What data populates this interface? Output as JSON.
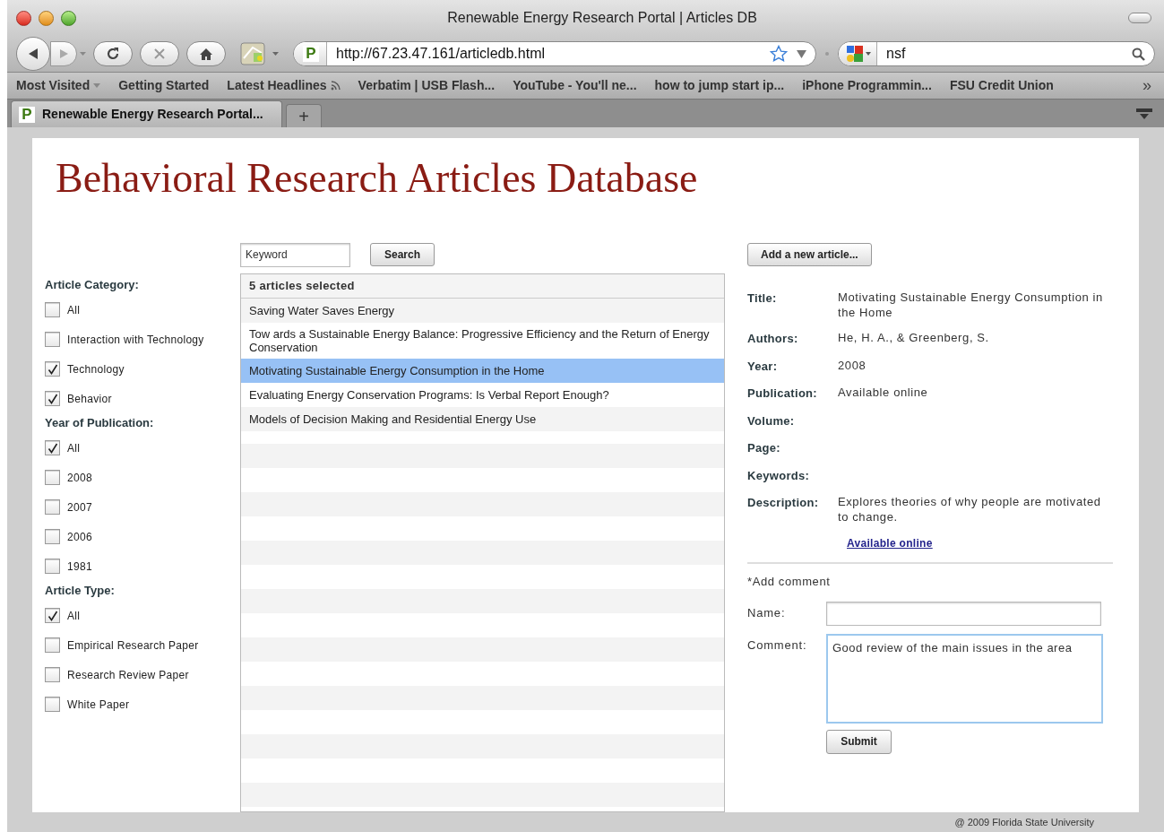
{
  "browser": {
    "title": "Renewable Energy Research Portal | Articles DB",
    "url": "http://67.23.47.161/articledb.html",
    "search_value": "nsf",
    "site_letter": "P",
    "bookmarks": [
      {
        "label": "Most Visited",
        "kind": "menu"
      },
      {
        "label": "Getting Started",
        "kind": "link"
      },
      {
        "label": "Latest Headlines",
        "kind": "feed"
      },
      {
        "label": "Verbatim | USB Flash...",
        "kind": "link"
      },
      {
        "label": "YouTube - You'll ne...",
        "kind": "link"
      },
      {
        "label": "how to jump start ip...",
        "kind": "link"
      },
      {
        "label": "iPhone Programmin...",
        "kind": "link"
      },
      {
        "label": "FSU Credit Union",
        "kind": "link"
      }
    ],
    "more": "»",
    "tabs": [
      {
        "label": "Renewable Energy Research Portal...",
        "site_letter": "P",
        "selected": true
      }
    ],
    "new_tab": "+"
  },
  "page": {
    "heading": "Behavioral Research Articles Database",
    "keyword_placeholder": "Keyword",
    "search_button": "Search",
    "add_button": "Add a new article...",
    "filters": [
      {
        "title": "Article Category:",
        "options": [
          {
            "label": "All",
            "checked": false
          },
          {
            "label": "Interaction with Technology",
            "checked": false
          },
          {
            "label": "Technology",
            "checked": true
          },
          {
            "label": "Behavior",
            "checked": true
          }
        ]
      },
      {
        "title": "Year of Publication:",
        "options": [
          {
            "label": "All",
            "checked": true
          },
          {
            "label": "2008",
            "checked": false
          },
          {
            "label": "2007",
            "checked": false
          },
          {
            "label": "2006",
            "checked": false
          },
          {
            "label": "1981",
            "checked": false
          }
        ]
      },
      {
        "title": "Article Type:",
        "options": [
          {
            "label": "All",
            "checked": true
          },
          {
            "label": "Empirical Research Paper",
            "checked": false
          },
          {
            "label": "Research Review Paper",
            "checked": false
          },
          {
            "label": "White Paper",
            "checked": false
          }
        ]
      }
    ],
    "articles": {
      "header": "5 articles selected",
      "items": [
        {
          "title": "Saving Water Saves Energy",
          "selected": false
        },
        {
          "title": "Tow ards a Sustainable Energy Balance: Progressive Efficiency and the Return of Energy Conservation",
          "selected": false
        },
        {
          "title": "Motivating Sustainable Energy Consumption in the Home",
          "selected": true
        },
        {
          "title": "Evaluating Energy Conservation Programs: Is Verbal Report Enough?",
          "selected": false
        },
        {
          "title": "Models of Decision Making and Residential Energy Use",
          "selected": false
        }
      ]
    },
    "details": [
      {
        "label": "Title:",
        "value": "Motivating Sustainable Energy Consumption in the Home"
      },
      {
        "label": "Authors:",
        "value": "He, H. A., & Greenberg, S."
      },
      {
        "label": "Year:",
        "value": "2008"
      },
      {
        "label": "Publication:",
        "value": "Available online"
      },
      {
        "label": "Volume:"
      },
      {
        "label": "Page:"
      },
      {
        "label": "Keywords:"
      },
      {
        "label": "Description:",
        "value": "Explores theories of why people are motivated to change."
      }
    ],
    "link": "Available online",
    "comment": {
      "heading": "*Add comment",
      "name_label": "Name:",
      "comment_label": "Comment:",
      "comment_value": "Good review of the main issues in the area",
      "submit": "Submit"
    },
    "footer": "@ 2009 Florida State University"
  }
}
